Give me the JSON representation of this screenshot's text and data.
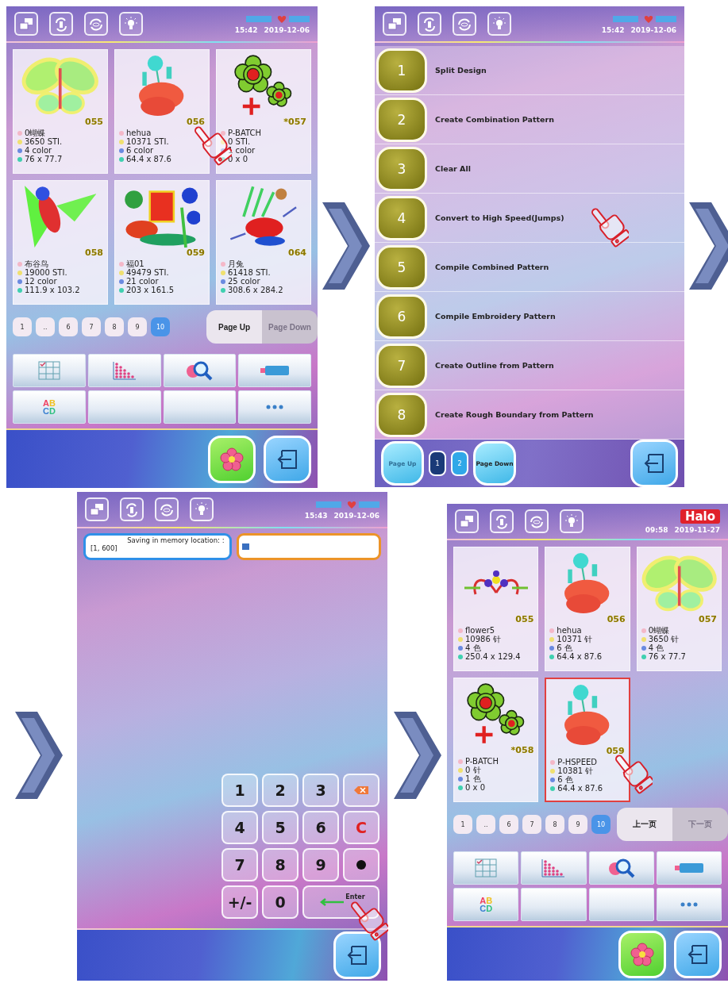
{
  "panels": [
    {
      "kind": "designs",
      "header": {
        "logo": {
          "kind": "blurred"
        },
        "time": "15:42",
        "date": "2019-12-06"
      },
      "designs": [
        {
          "kind": "butterfly",
          "number": "055",
          "name": "0蝴蝶",
          "stitches": "3650 STI.",
          "colors": "4 color",
          "size": "76 x 77.7",
          "selected": false,
          "pointed": false
        },
        {
          "kind": "lotus",
          "number": "056",
          "name": "hehua",
          "stitches": "10371 STI.",
          "colors": "6 color",
          "size": "64.4 x 87.6",
          "selected": false,
          "pointed": true
        },
        {
          "kind": "flowers",
          "number": "*057",
          "name": "P-BATCH",
          "stitches": "0 STI.",
          "colors": "1 color",
          "size": "0 x 0",
          "selected": false,
          "pointed": false
        },
        {
          "kind": "bird",
          "number": "058",
          "name": "布谷鸟",
          "stitches": "19000 STI.",
          "colors": "12 color",
          "size": "111.9 x 103.2",
          "selected": false,
          "pointed": false
        },
        {
          "kind": "fu",
          "number": "059",
          "name": "福01",
          "stitches": "49479 STI.",
          "colors": "21 color",
          "size": "203 x 161.5",
          "selected": false,
          "pointed": false
        },
        {
          "kind": "rabbit",
          "number": "064",
          "name": "月兔",
          "stitches": "61418 STI.",
          "colors": "25 color",
          "size": "308.6 x 284.2",
          "selected": false,
          "pointed": false
        }
      ],
      "pagination": {
        "pages": [
          {
            "label": "1",
            "selected": false
          },
          {
            "label": "..",
            "selected": false
          },
          {
            "label": "6",
            "selected": false
          },
          {
            "label": "7",
            "selected": false
          },
          {
            "label": "8",
            "selected": false
          },
          {
            "label": "9",
            "selected": false
          },
          {
            "label": "10",
            "selected": true
          }
        ],
        "page_up": {
          "label": "Page Up",
          "disabled": false
        },
        "page_down": {
          "label": "Page Down",
          "disabled": true
        }
      },
      "tools": [
        {
          "kind": "grid"
        },
        {
          "kind": "stitches"
        },
        {
          "kind": "search"
        },
        {
          "kind": "tag"
        },
        {
          "kind": "letters",
          "label": "ABCD"
        },
        {
          "kind": "blank"
        },
        {
          "kind": "blank"
        },
        {
          "kind": "more"
        }
      ]
    },
    {
      "kind": "menu",
      "header": {
        "logo": {
          "kind": "blurred"
        },
        "time": "15:42",
        "date": "2019-12-06"
      },
      "items": [
        {
          "number": "1",
          "label": "Split Design",
          "pointed": false
        },
        {
          "number": "2",
          "label": "Create Combination Pattern",
          "pointed": false
        },
        {
          "number": "3",
          "label": "Clear All",
          "pointed": false
        },
        {
          "number": "4",
          "label": "Convert to High Speed(Jumps)",
          "pointed": true
        },
        {
          "number": "5",
          "label": "Compile Combined Pattern",
          "pointed": false
        },
        {
          "number": "6",
          "label": "Compile Embroidery Pattern",
          "pointed": false
        },
        {
          "number": "7",
          "label": "Create Outline from Pattern",
          "pointed": false
        },
        {
          "number": "8",
          "label": "Create Rough Boundary from Pattern",
          "pointed": false
        }
      ],
      "pager": {
        "page_up": {
          "label": "Page Up",
          "disabled": true
        },
        "pages": [
          {
            "label": "1",
            "selected": true
          },
          {
            "label": "2",
            "selected": false
          }
        ],
        "page_down": {
          "label": "Page Down",
          "disabled": false
        }
      }
    },
    {
      "kind": "keypad",
      "header": {
        "logo": {
          "kind": "blurred"
        },
        "time": "15:43",
        "date": "2019-12-06"
      },
      "location": {
        "label": "Saving in memory location: :",
        "range": "[1, 600]"
      },
      "keys": [
        {
          "kind": "digit",
          "label": "1",
          "pointed": false
        },
        {
          "kind": "digit",
          "label": "2",
          "pointed": false
        },
        {
          "kind": "digit",
          "label": "3",
          "pointed": false
        },
        {
          "kind": "backspace",
          "pointed": false
        },
        {
          "kind": "digit",
          "label": "4",
          "pointed": false
        },
        {
          "kind": "digit",
          "label": "5",
          "pointed": false
        },
        {
          "kind": "digit",
          "label": "6",
          "pointed": false
        },
        {
          "kind": "clear",
          "label": "C",
          "pointed": false
        },
        {
          "kind": "digit",
          "label": "7",
          "pointed": false
        },
        {
          "kind": "digit",
          "label": "8",
          "pointed": false
        },
        {
          "kind": "digit",
          "label": "9",
          "pointed": false
        },
        {
          "kind": "dot",
          "pointed": false
        },
        {
          "kind": "digit",
          "label": "+/-",
          "pointed": false
        },
        {
          "kind": "digit",
          "label": "0",
          "pointed": false
        },
        {
          "kind": "enter",
          "label": "Enter",
          "pointed": true
        }
      ]
    },
    {
      "kind": "designs",
      "header": {
        "logo": {
          "kind": "halo",
          "text": "Halo"
        },
        "time": "09:58",
        "date": "2019-11-27"
      },
      "designs": [
        {
          "kind": "ornament",
          "number": "055",
          "name": "flower5",
          "stitches": "10986 针",
          "colors": "4 色",
          "size": "250.4 x 129.4",
          "selected": false,
          "pointed": false
        },
        {
          "kind": "lotus",
          "number": "056",
          "name": "hehua",
          "stitches": "10371 针",
          "colors": "6 色",
          "size": "64.4 x 87.6",
          "selected": false,
          "pointed": false
        },
        {
          "kind": "butterfly",
          "number": "057",
          "name": "0蝴蝶",
          "stitches": "3650 针",
          "colors": "4 色",
          "size": "76 x 77.7",
          "selected": false,
          "pointed": false
        },
        {
          "kind": "flowers",
          "number": "*058",
          "name": "P-BATCH",
          "stitches": "0 针",
          "colors": "1 色",
          "size": "0 x 0",
          "selected": false,
          "pointed": false
        },
        {
          "kind": "lotus",
          "number": "059",
          "name": "P-HSPEED",
          "stitches": "10381 针",
          "colors": "6 色",
          "size": "64.4 x 87.6",
          "selected": true,
          "pointed": true
        }
      ],
      "pagination": {
        "pages": [
          {
            "label": "1",
            "selected": false
          },
          {
            "label": "..",
            "selected": false
          },
          {
            "label": "6",
            "selected": false
          },
          {
            "label": "7",
            "selected": false
          },
          {
            "label": "8",
            "selected": false
          },
          {
            "label": "9",
            "selected": false
          },
          {
            "label": "10",
            "selected": true
          }
        ],
        "page_up": {
          "label": "上一页",
          "disabled": false
        },
        "page_down": {
          "label": "下一页",
          "disabled": true
        }
      },
      "tools": [
        {
          "kind": "grid"
        },
        {
          "kind": "stitches"
        },
        {
          "kind": "search"
        },
        {
          "kind": "tag"
        },
        {
          "kind": "letters",
          "label": "ABCD"
        },
        {
          "kind": "blank"
        },
        {
          "kind": "blank"
        },
        {
          "kind": "more"
        }
      ]
    }
  ]
}
